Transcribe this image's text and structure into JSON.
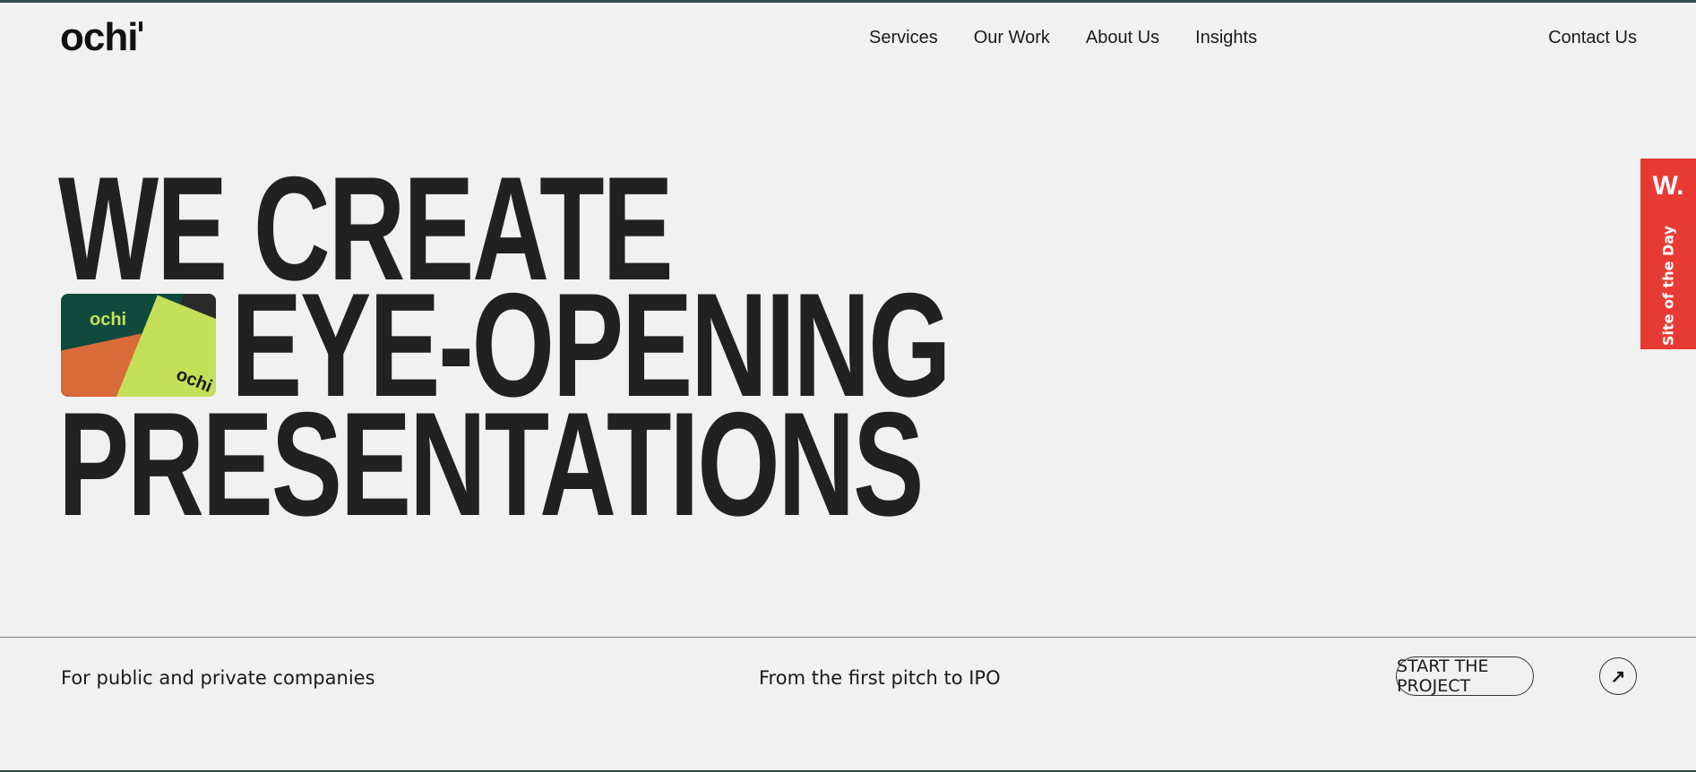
{
  "brand": {
    "logo_text": "ochi"
  },
  "nav": {
    "items": [
      {
        "label": "Services"
      },
      {
        "label": "Our Work"
      },
      {
        "label": "About Us"
      },
      {
        "label": "Insights"
      }
    ],
    "contact_label": "Contact Us"
  },
  "hero": {
    "line1": "WE CREATE",
    "line2": "EYE-OPENING",
    "line3": "PRESENTATIONS",
    "thumb_brand_text": "ochi"
  },
  "badge": {
    "mark": "W.",
    "label": "Site of the Day",
    "color": "#e83a35"
  },
  "footer_strip": {
    "left_text": "For public and private companies",
    "mid_text": "From the first pitch to IPO",
    "cta_label": "START THE PROJECT",
    "cta_icon": "arrow-up-right-icon"
  }
}
